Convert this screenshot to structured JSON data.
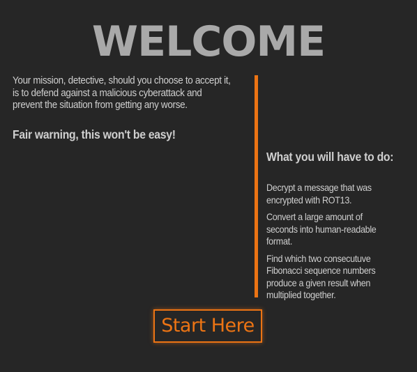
{
  "header": {
    "title": "WELCOME"
  },
  "intro": {
    "mission_text": "Your mission, detective, should you choose to accept it, is to defend against a malicious cyberattack and prevent the situation from getting any worse.",
    "warning_text": "Fair warning, this won't be easy!"
  },
  "tasks": {
    "heading": "What you will have to do:",
    "items": [
      {
        "text": "Decrypt a message that was encrypted with ROT13."
      },
      {
        "text": "Convert a large amount of seconds into human-readable format."
      },
      {
        "text": "Find which two consecutuve Fibonacci sequence numbers produce a given result when multiplied together."
      }
    ]
  },
  "actions": {
    "start_label": "Start Here"
  },
  "colors": {
    "background": "#262626",
    "accent": "#ec7414",
    "title": "#a9a9a9",
    "text": "#cfcfcf"
  }
}
